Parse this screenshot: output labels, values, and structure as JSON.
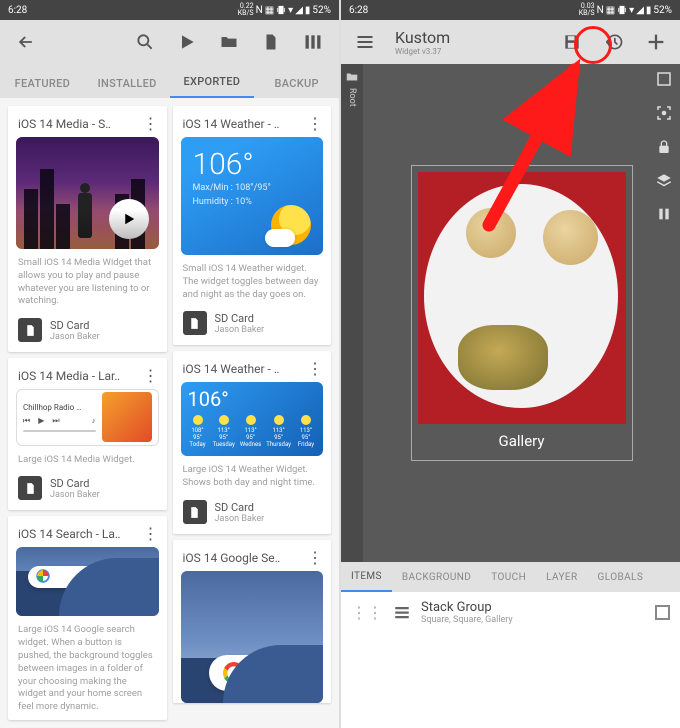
{
  "status": {
    "time": "6:28",
    "kb": "0.22",
    "kbUnit": "KB/S",
    "battery": "52%"
  },
  "s1": {
    "tabs": [
      "FEATURED",
      "INSTALLED",
      "EXPORTED",
      "BACKUP"
    ],
    "activeTab": 2,
    "cards": {
      "media_small": {
        "title": "iOS 14 Media - S‥",
        "desc": "Small iOS 14 Media Widget that allows you to play and pause whatever you are listening to or watching.",
        "m1": "SD Card",
        "m2": "Jason Baker"
      },
      "weather_big": {
        "title": "iOS 14 Weather - ‥",
        "temp": "106°",
        "l1": "Max/Min : 108°/95°",
        "l2": "Humidity : 10%",
        "desc": "Small iOS 14 Weather widget. The widget toggles between day and night as the day goes on.",
        "m1": "SD Card",
        "m2": "Jason Baker"
      },
      "media_large": {
        "title": "iOS 14 Media - Lar‥",
        "track": "Chillhop Radio …",
        "desc": "Large iOS 14 Media Widget.",
        "m1": "SD Card",
        "m2": "Jason Baker"
      },
      "weather_small": {
        "title": "iOS 14 Weather - ‥",
        "temp": "106°",
        "days": [
          "Today",
          "Tuesday",
          "Wednes",
          "Thursday",
          "Friday"
        ],
        "highs": [
          "108°",
          "113°",
          "113°",
          "113°",
          "113°"
        ],
        "lows": [
          "95°",
          "95°",
          "95°",
          "95°",
          "95°"
        ],
        "desc": "Large iOS 14 Weather Widget. Shows both day and night time.",
        "m1": "SD Card",
        "m2": "Jason Baker"
      },
      "search": {
        "title": "iOS 14 Search - La‥",
        "desc": "Large iOS 14 Google search widget. When a button is pushed, the background toggles between images in a folder of your choosing making the widget and your home screen feel more dynamic."
      },
      "google": {
        "title": "iOS 14 Google Se‥"
      }
    }
  },
  "s2": {
    "status": {
      "time": "6:28",
      "kb": "0.03",
      "kbUnit": "KB/S",
      "battery": "52%"
    },
    "app": {
      "name": "Kustom",
      "version": "Widget v3.37"
    },
    "rootLabel": "Root",
    "galleryLabel": "Gallery",
    "tabs": [
      "ITEMS",
      "BACKGROUND",
      "TOUCH",
      "LAYER",
      "GLOBALS"
    ],
    "activeTab": 0,
    "item": {
      "name": "Stack Group",
      "sub": "Square, Square, Gallery"
    }
  }
}
